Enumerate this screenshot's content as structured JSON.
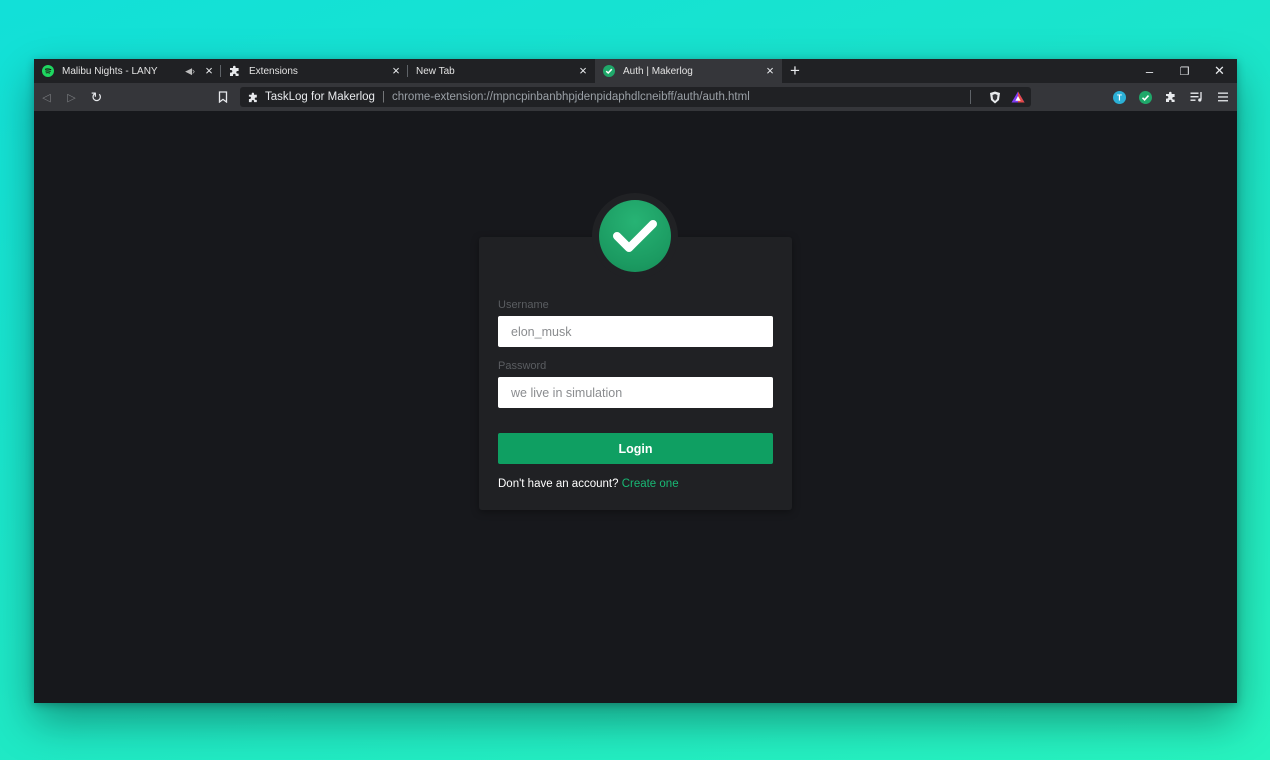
{
  "tabs": [
    {
      "title": "Malibu Nights - LANY",
      "icon": "spotify-icon",
      "audio": "◀›",
      "active": false
    },
    {
      "title": "Extensions",
      "icon": "puzzle-icon",
      "active": false
    },
    {
      "title": "New Tab",
      "icon": "",
      "active": false
    },
    {
      "title": "Auth | Makerlog",
      "icon": "check-circle-icon",
      "active": true
    }
  ],
  "window_controls": {
    "minimize": "–",
    "restore": "❐",
    "close": "✕"
  },
  "toolbar": {
    "back": "◁",
    "forward": "▷",
    "reload": "↻",
    "extension_name": "TaskLog for Makerlog",
    "url": "chrome-extension://mpncpinbanbhpjdenpidaphdlcneibff/auth/auth.html"
  },
  "login": {
    "username_label": "Username",
    "username_value": "elon_musk",
    "password_label": "Password",
    "password_value": "we live in simulation",
    "button": "Login",
    "signup_text": "Don't have an account?",
    "signup_link": "Create one"
  },
  "colors": {
    "accent": "#0f9f62",
    "link": "#18b874",
    "background": "#17181c",
    "card": "#202124"
  }
}
